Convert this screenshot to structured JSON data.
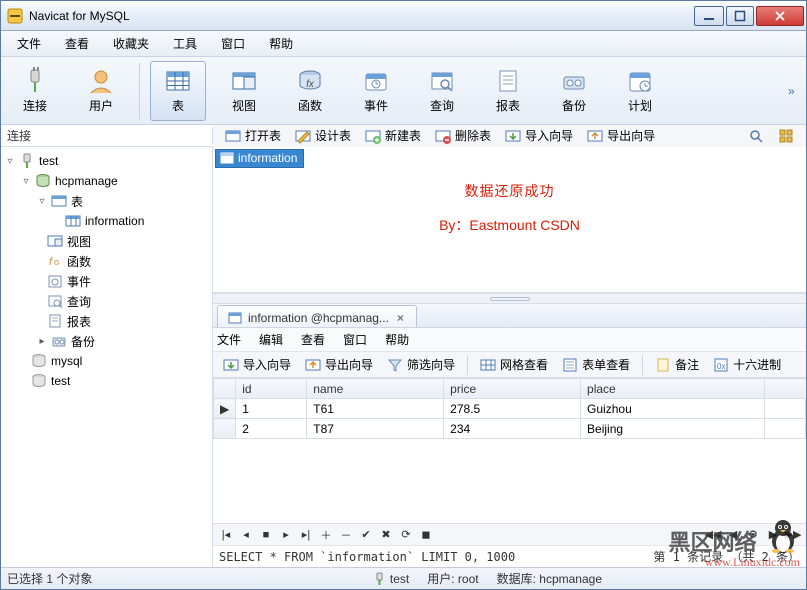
{
  "window": {
    "title": "Navicat for MySQL"
  },
  "menu": [
    "文件",
    "查看",
    "收藏夹",
    "工具",
    "窗口",
    "帮助"
  ],
  "toolbar": [
    {
      "key": "connect",
      "label": "连接"
    },
    {
      "key": "user",
      "label": "用户"
    },
    {
      "key": "table",
      "label": "表",
      "active": true
    },
    {
      "key": "view",
      "label": "视图"
    },
    {
      "key": "func",
      "label": "函数"
    },
    {
      "key": "event",
      "label": "事件"
    },
    {
      "key": "query",
      "label": "查询"
    },
    {
      "key": "report",
      "label": "报表"
    },
    {
      "key": "backup",
      "label": "备份"
    },
    {
      "key": "plan",
      "label": "计划"
    }
  ],
  "conn_label": "连接",
  "small_toolbar": {
    "open": "打开表",
    "design": "设计表",
    "new": "新建表",
    "delete": "删除表",
    "import": "导入向导",
    "export": "导出向导"
  },
  "tree": {
    "root": {
      "name": "test"
    },
    "db": {
      "name": "hcpmanage"
    },
    "groups": {
      "table": "表",
      "view": "视图",
      "func": "函数",
      "event": "事件",
      "query": "查询",
      "report": "报表",
      "backup": "备份"
    },
    "table_item": "information",
    "siblings": [
      "mysql",
      "test"
    ]
  },
  "upper": {
    "chip": "information",
    "msg1": "数据还原成功",
    "msg2": "By：Eastmount CSDN"
  },
  "sub": {
    "tab": "information @hcpmanag...",
    "menu": [
      "文件",
      "编辑",
      "查看",
      "窗口",
      "帮助"
    ],
    "tb": {
      "import": "导入向导",
      "export": "导出向导",
      "filter": "筛选向导",
      "gridview": "网格查看",
      "formview": "表单查看",
      "memo": "备注",
      "hex": "十六进制"
    },
    "columns": [
      "id",
      "name",
      "price",
      "place"
    ],
    "rows": [
      {
        "id": "1",
        "name": "T61",
        "price": "278.5",
        "place": "Guizhou"
      },
      {
        "id": "2",
        "name": "T87",
        "price": "234",
        "place": "Beijing"
      }
    ],
    "sql": "SELECT * FROM `information` LIMIT 0, 1000",
    "record_label": "第 1 条记录 （共 2 条）"
  },
  "status": {
    "left": "已选择 1 个对象",
    "mid_conn": "test",
    "mid_user_lbl": "用户:",
    "mid_user": "root",
    "mid_db_lbl": "数据库:",
    "mid_db": "hcpmanage"
  },
  "watermark": {
    "t1": "黑区网络",
    "t2": "www.Linuxidc.com"
  }
}
